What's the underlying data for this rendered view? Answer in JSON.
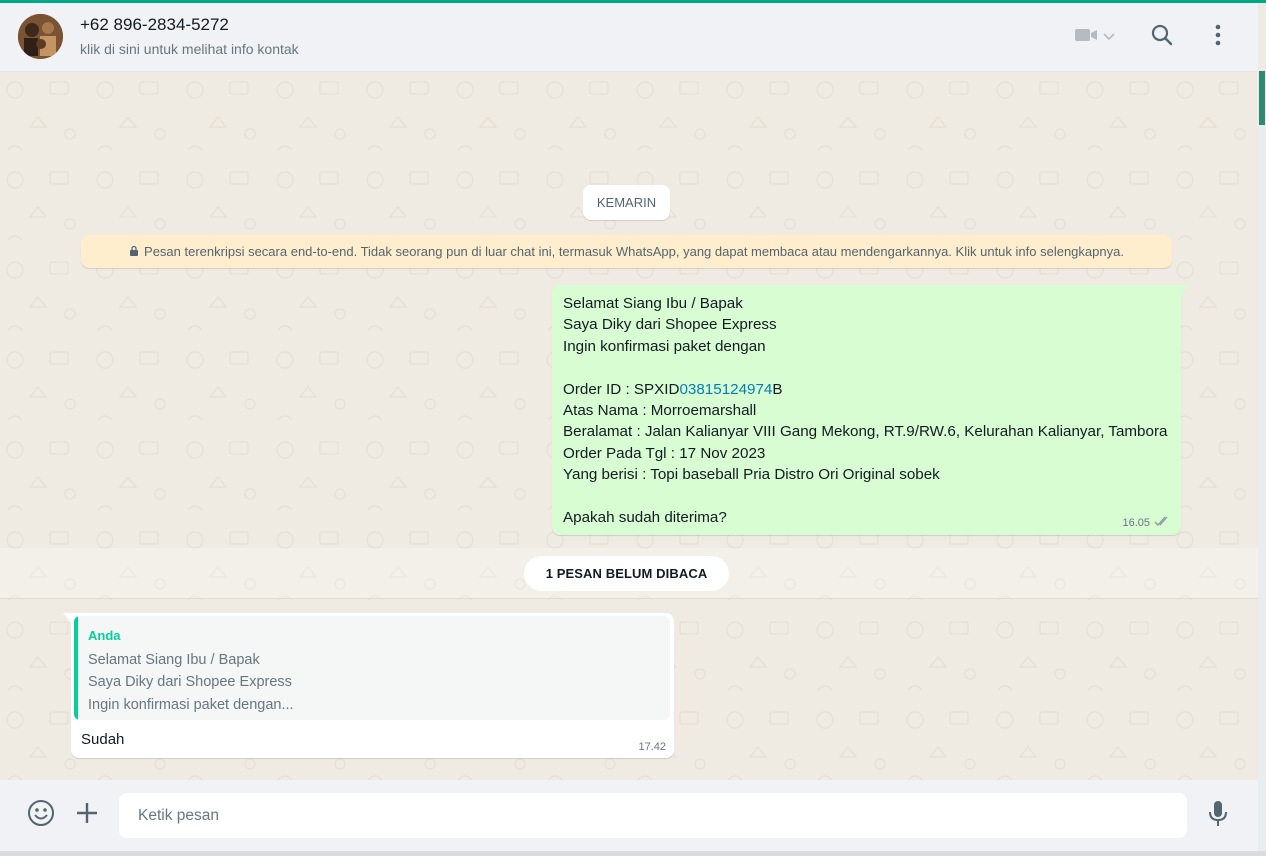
{
  "header": {
    "contact_name": "+62 896-2834-5272",
    "contact_subtitle": "klik di sini untuk melihat info kontak",
    "icons": [
      "video-call-icon",
      "chevron-down-icon",
      "search-icon",
      "menu-dots-icon"
    ]
  },
  "chat": {
    "date_chip": "KEMARIN",
    "encryption_notice": "Pesan terenkripsi secara end-to-end. Tidak seorang pun di luar chat ini, termasuk WhatsApp, yang dapat membaca atau mendengarkannya. Klik untuk info selengkapnya.",
    "outgoing": {
      "line1": "Selamat Siang Ibu / Bapak",
      "line2": "Saya Diky dari Shopee Express",
      "line3": "Ingin konfirmasi paket dengan",
      "order_prefix": "Order ID : SPXID",
      "order_link": "03815124974",
      "order_suffix": "B",
      "line5": "Atas Nama : Morroemarshall",
      "line6": "Beralamat : Jalan Kalianyar VIII Gang Mekong, RT.9/RW.6, Kelurahan Kalianyar, Tambora",
      "line7": "Order Pada Tgl : 17 Nov 2023",
      "line8": "Yang berisi : Topi baseball Pria Distro Ori Original sobek",
      "line9": "Apakah sudah diterima?",
      "time": "16.05",
      "status_icon": "double-check-icon"
    },
    "unread_chip": "1 PESAN BELUM DIBACA",
    "incoming": {
      "quote_author": "Anda",
      "quote_line1": "Selamat Siang Ibu / Bapak",
      "quote_line2": "Saya Diky dari Shopee Express",
      "quote_line3": "Ingin konfirmasi paket dengan...",
      "text": "Sudah",
      "time": "17.42"
    }
  },
  "footer": {
    "placeholder": "Ketik pesan",
    "icons": [
      "emoji-icon",
      "attach-plus-icon",
      "microphone-icon"
    ]
  },
  "colors": {
    "accent": "#00a884",
    "outgoing_bubble": "#d9fdd3",
    "incoming_bubble": "#ffffff",
    "chat_background": "#efeae2",
    "link": "#027eb5",
    "quote_author": "#06cf9c"
  }
}
